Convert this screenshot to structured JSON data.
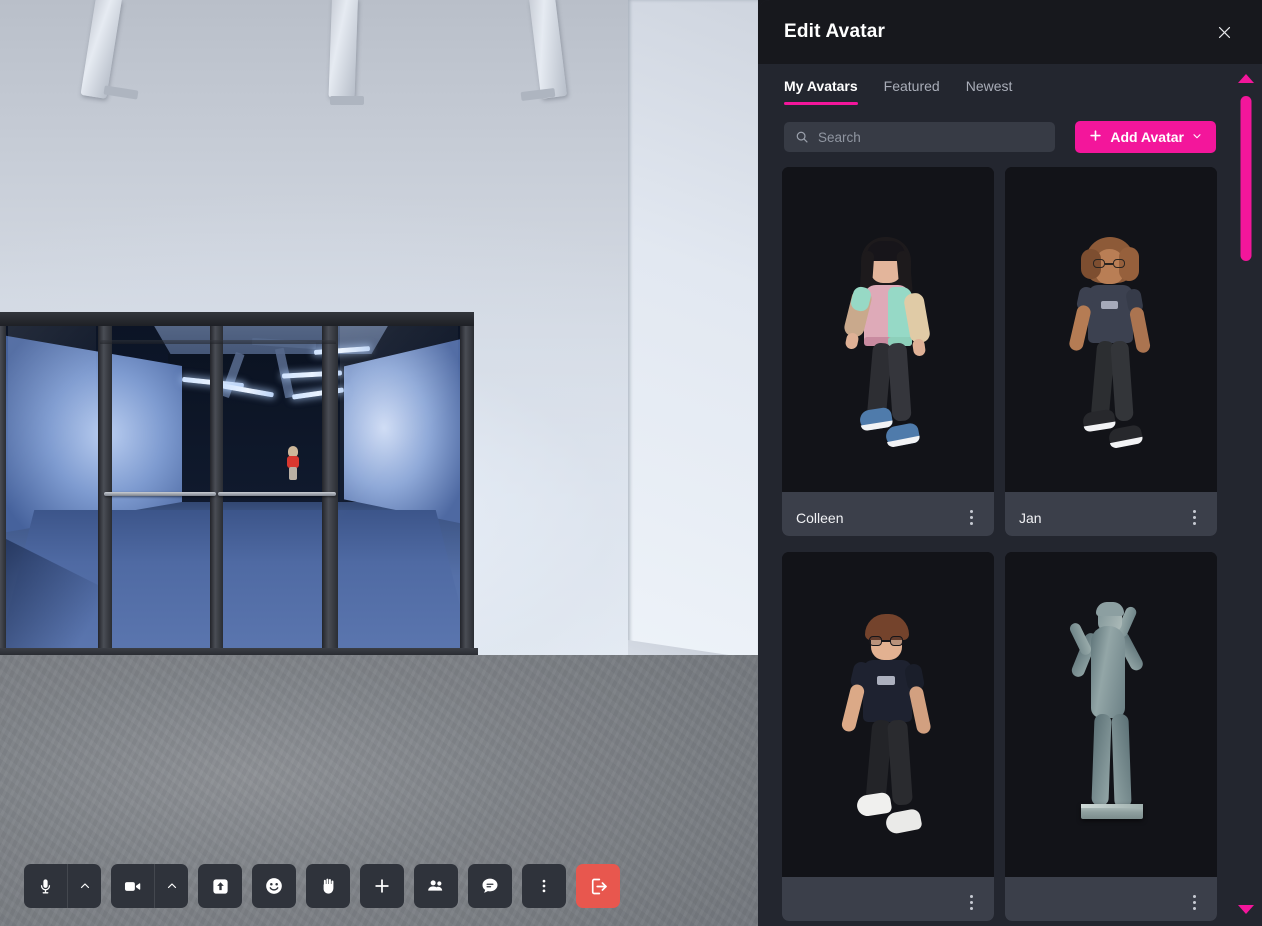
{
  "panel": {
    "title": "Edit Avatar",
    "close_icon": "close-icon",
    "tabs": [
      {
        "label": "My Avatars",
        "active": true
      },
      {
        "label": "Featured",
        "active": false
      },
      {
        "label": "Newest",
        "active": false
      }
    ],
    "search": {
      "placeholder": "Search",
      "value": "",
      "icon": "search-icon"
    },
    "add_avatar": {
      "label": "Add Avatar",
      "plus_icon": "plus-icon",
      "chevron_icon": "chevron-down-icon"
    },
    "avatars": [
      {
        "name": "Colleen",
        "menu_icon": "kebab-menu-icon"
      },
      {
        "name": "Jan",
        "menu_icon": "kebab-menu-icon"
      },
      {
        "name": "",
        "menu_icon": "kebab-menu-icon"
      },
      {
        "name": "",
        "menu_icon": "kebab-menu-icon"
      }
    ],
    "scrollbar": {
      "up_icon": "scroll-up-arrow-icon",
      "down_icon": "scroll-down-arrow-icon"
    }
  },
  "toolbar": {
    "buttons": [
      {
        "name": "microphone",
        "icon": "microphone-icon",
        "has_caret": true,
        "caret_icon": "chevron-up-icon"
      },
      {
        "name": "camera",
        "icon": "camera-icon",
        "has_caret": true,
        "caret_icon": "chevron-up-icon"
      },
      {
        "name": "share-screen",
        "icon": "share-screen-icon",
        "has_caret": false
      },
      {
        "name": "reactions",
        "icon": "smiley-face-icon",
        "has_caret": false
      },
      {
        "name": "raise-hand",
        "icon": "raised-hand-icon",
        "has_caret": false
      },
      {
        "name": "add",
        "icon": "plus-icon",
        "has_caret": false
      },
      {
        "name": "participants",
        "icon": "people-icon",
        "has_caret": false
      },
      {
        "name": "chat",
        "icon": "chat-bubble-icon",
        "has_caret": false
      },
      {
        "name": "more-options",
        "icon": "kebab-menu-icon",
        "has_caret": false
      },
      {
        "name": "leave",
        "icon": "exit-door-icon",
        "has_caret": false
      }
    ]
  },
  "colors": {
    "accent_pink": "#f3169b",
    "panel_body": "#23262f",
    "panel_header": "#17181d",
    "card_bg": "#121318",
    "card_bar": "#3b3f4a",
    "toolbar_btn": "#2f333b",
    "leave_red": "#e8574e"
  }
}
